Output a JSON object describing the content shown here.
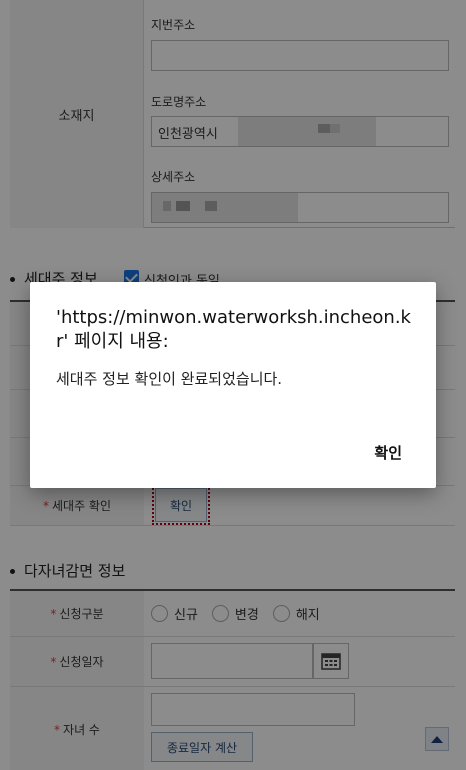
{
  "address": {
    "label": "소재지",
    "jibun_label": "지번주소",
    "jibun_value": "",
    "road_label": "도로명주소",
    "road_value": "인천광역시",
    "detail_label": "상세주소",
    "detail_value": ""
  },
  "household": {
    "section_title": "세대주 정보",
    "consent_label": "신청인과 동일",
    "consent_checked": true,
    "confirm_label": "세대주 확인",
    "confirm_button": "확인"
  },
  "multichild": {
    "section_title": "다자녀감면 정보",
    "apply_type_label": "신청구분",
    "apply_options": [
      "신규",
      "변경",
      "해지"
    ],
    "apply_date_label": "신청일자",
    "apply_date_value": "",
    "children_label": "자녀 수",
    "children_value": "",
    "calc_button": "종료일자 계산"
  },
  "dialog": {
    "title": "'https://minwon.waterworksh.incheon.kr' 페이지 내용:",
    "message": "세대주 정보 확인이 완료되었습니다.",
    "ok_button": "확인"
  },
  "colors": {
    "required_mark": "#e53935",
    "checkbox": "#1a73e8",
    "button_text": "#2b4a74",
    "focus_outline": "#b00020"
  }
}
